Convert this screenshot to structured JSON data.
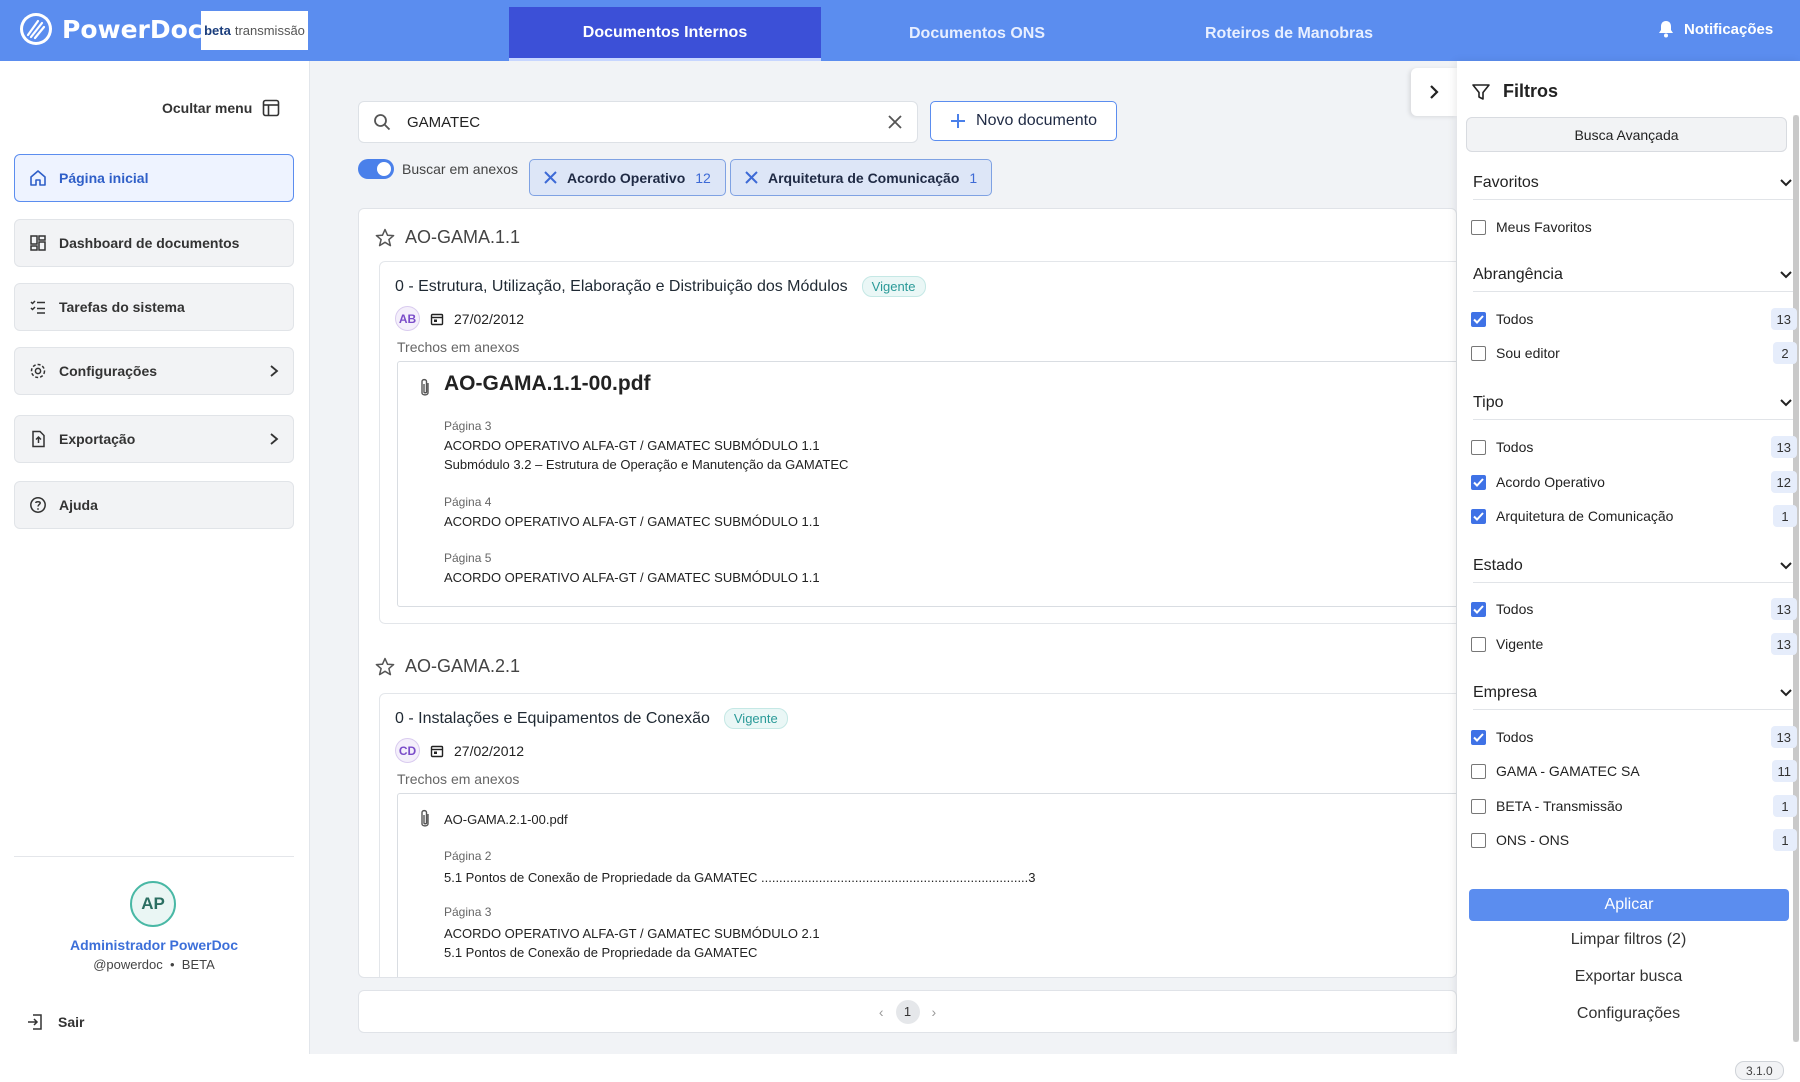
{
  "brand": {
    "name": "PowerDoc",
    "badge_bold": "beta",
    "badge_rest": "transmissão"
  },
  "tabs": [
    {
      "label": "Documentos Internos",
      "active": true
    },
    {
      "label": "Documentos ONS",
      "active": false
    },
    {
      "label": "Roteiros de Manobras",
      "active": false
    }
  ],
  "notifications_label": "Notificações",
  "sidebar": {
    "hide_menu_label": "Ocultar menu",
    "items": [
      {
        "label": "Página inicial",
        "icon": "home-icon"
      },
      {
        "label": "Dashboard de documentos",
        "icon": "dashboard-icon"
      },
      {
        "label": "Tarefas do sistema",
        "icon": "tasks-icon"
      },
      {
        "label": "Configurações",
        "icon": "gear-icon"
      },
      {
        "label": "Exportação",
        "icon": "export-icon"
      },
      {
        "label": "Ajuda",
        "icon": "help-icon"
      }
    ],
    "user": {
      "initials": "AP",
      "name": "Administrador PowerDoc",
      "handle": "@powerdoc",
      "tenant": "BETA"
    },
    "logout_label": "Sair"
  },
  "search": {
    "value": "GAMATEC",
    "new_doc_label": "Novo documento",
    "toggle_label": "Buscar em anexos",
    "toggle_on": true
  },
  "chips": [
    {
      "label": "Acordo Operativo",
      "count": "12"
    },
    {
      "label": "Arquitetura de Comunicação",
      "count": "1"
    }
  ],
  "results": [
    {
      "code": "AO-GAMA.1.1",
      "revision": "0 - Estrutura, Utilização, Elaboração e Distribuição dos Módulos",
      "status": "Vigente",
      "author": "AB",
      "date": "27/02/2012",
      "trechos_label": "Trechos em anexos",
      "file": "AO-GAMA.1.1-00.pdf",
      "hits": [
        {
          "page": "Página 3",
          "lines": [
            "ACORDO OPERATIVO ALFA-GT  /  GAMATEC  SUBMÓDULO 1.1",
            "Submódulo 3.2 – Estrutura de Operação e Manutenção da  GAMATEC"
          ]
        },
        {
          "page": "Página 4",
          "lines": [
            "ACORDO OPERATIVO ALFA-GT  /  GAMATEC  SUBMÓDULO 1.1"
          ]
        },
        {
          "page": "Página 5",
          "lines": [
            "ACORDO OPERATIVO ALFA-GT  /  GAMATEC  SUBMÓDULO 1.1"
          ]
        }
      ]
    },
    {
      "code": "AO-GAMA.2.1",
      "revision": "0 - Instalações e Equipamentos de Conexão",
      "status": "Vigente",
      "author": "CD",
      "date": "27/02/2012",
      "trechos_label": "Trechos em anexos",
      "file": "AO-GAMA.2.1-00.pdf",
      "hits": [
        {
          "page": "Página 2",
          "lines": [
            "5.1 Pontos de Conexão de Propriedade da  GAMATEC  ..........................................................................3"
          ]
        },
        {
          "page": "Página 3",
          "lines": [
            "ACORDO OPERATIVO ALFA-GT  /  GAMATEC  SUBMÓDULO 2.1",
            "5.1 Pontos de Conexão de Propriedade da  GAMATEC"
          ]
        }
      ]
    }
  ],
  "pagination": {
    "current": "1"
  },
  "filters": {
    "title": "Filtros",
    "advanced_label": "Busca Avançada",
    "sections": [
      {
        "title": "Favoritos",
        "options": [
          {
            "label": "Meus Favoritos",
            "checked": false,
            "count": ""
          }
        ]
      },
      {
        "title": "Abrangência",
        "options": [
          {
            "label": "Todos",
            "checked": true,
            "count": "13"
          },
          {
            "label": "Sou editor",
            "checked": false,
            "count": "2"
          }
        ]
      },
      {
        "title": "Tipo",
        "options": [
          {
            "label": "Todos",
            "checked": false,
            "count": "13"
          },
          {
            "label": "Acordo Operativo",
            "checked": true,
            "count": "12"
          },
          {
            "label": "Arquitetura de Comunicação",
            "checked": true,
            "count": "1"
          }
        ]
      },
      {
        "title": "Estado",
        "options": [
          {
            "label": "Todos",
            "checked": true,
            "count": "13"
          },
          {
            "label": "Vigente",
            "checked": false,
            "count": "13"
          }
        ]
      },
      {
        "title": "Empresa",
        "options": [
          {
            "label": "Todos",
            "checked": true,
            "count": "13"
          },
          {
            "label": "GAMA  -  GAMATEC  SA",
            "checked": false,
            "count": "11"
          },
          {
            "label": "BETA  -  Transmissão",
            "checked": false,
            "count": "1"
          },
          {
            "label": "ONS  -  ONS",
            "checked": false,
            "count": "1"
          }
        ]
      }
    ],
    "apply_label": "Aplicar",
    "clear_label": "Limpar filtros (2)",
    "export_label": "Exportar busca",
    "settings_label": "Configurações"
  },
  "version": "3.1.0",
  "colors": {
    "header": "#5b8def",
    "active_tab": "#3c50d7",
    "accent": "#3f72e6",
    "status": "#2a9a98"
  }
}
